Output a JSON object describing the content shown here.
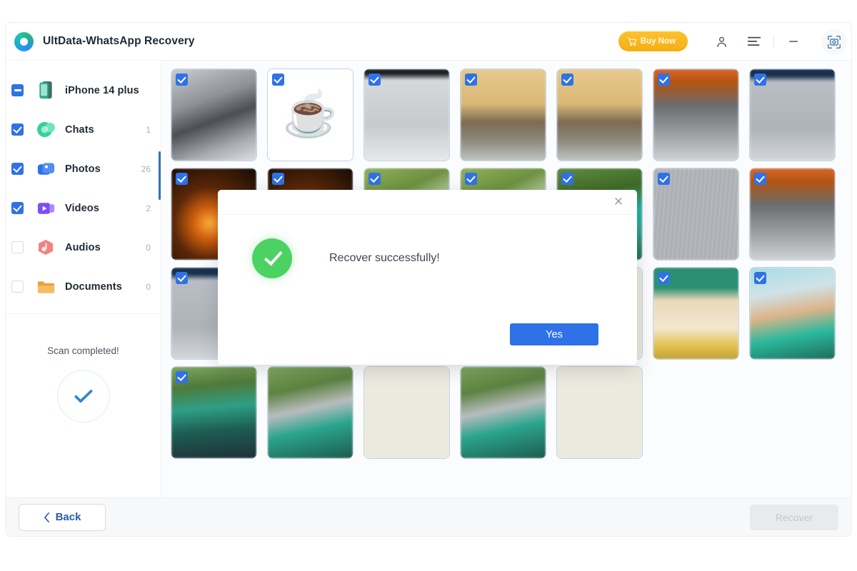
{
  "window": {
    "title": "UltData-WhatsApp Recovery",
    "logo_icon": "ultdata-ring-logo",
    "buy_now_label": "Buy Now",
    "buy_now_color": "#f5ae14",
    "cart_icon": "shopping-cart-icon",
    "user_icon": "user-account-icon",
    "menu_icon": "hamburger-menu-icon",
    "minimize_icon": "minimize-icon",
    "close_icon": "close-icon",
    "snip_icon": "screenshot-capture-icon"
  },
  "sidebar": {
    "items": [
      {
        "label": "iPhone 14 plus",
        "count": "",
        "checkbox": "indeterminate",
        "icon": "iphone-device-icon"
      },
      {
        "label": "Chats",
        "count": "1",
        "checkbox": "checked",
        "icon": "chats-icon"
      },
      {
        "label": "Photos",
        "count": "26",
        "checkbox": "checked",
        "icon": "photos-icon"
      },
      {
        "label": "Videos",
        "count": "2",
        "checkbox": "checked",
        "icon": "videos-icon"
      },
      {
        "label": "Audios",
        "count": "0",
        "checkbox": "unchecked",
        "icon": "audios-icon"
      },
      {
        "label": "Documents",
        "count": "0",
        "checkbox": "unchecked",
        "icon": "documents-icon"
      }
    ],
    "scan_status": "Scan completed!",
    "scan_icon": "check-mark-icon",
    "scan_accent": "#2f86d8"
  },
  "main": {
    "selected_color": "#2f72e8",
    "thumbnails": [
      {
        "art": "art-pen",
        "checked": true,
        "emoji": ""
      },
      {
        "art": "art-cup",
        "checked": true,
        "emoji": "☕"
      },
      {
        "art": "art-doc",
        "checked": true,
        "emoji": ""
      },
      {
        "art": "art-beach",
        "checked": true,
        "emoji": ""
      },
      {
        "art": "art-beach",
        "checked": true,
        "emoji": ""
      },
      {
        "art": "art-reel",
        "checked": true,
        "emoji": ""
      },
      {
        "art": "art-screen",
        "checked": true,
        "emoji": ""
      },
      {
        "art": "art-fire",
        "checked": true,
        "emoji": ""
      },
      {
        "art": "art-fire",
        "checked": true,
        "emoji": ""
      },
      {
        "art": "art-garden",
        "checked": true,
        "emoji": ""
      },
      {
        "art": "art-garden",
        "checked": true,
        "emoji": ""
      },
      {
        "art": "art-green",
        "checked": true,
        "emoji": ""
      },
      {
        "art": "art-grid",
        "checked": true,
        "emoji": ""
      },
      {
        "art": "art-reel",
        "checked": true,
        "emoji": ""
      },
      {
        "art": "art-screen",
        "checked": true,
        "emoji": ""
      },
      {
        "art": "art-blank",
        "checked": false,
        "emoji": ""
      },
      {
        "art": "art-blank",
        "checked": false,
        "emoji": ""
      },
      {
        "art": "art-blank",
        "checked": false,
        "emoji": ""
      },
      {
        "art": "art-blank",
        "checked": false,
        "emoji": ""
      },
      {
        "art": "art-latte",
        "checked": true,
        "emoji": ""
      },
      {
        "art": "art-shop",
        "checked": true,
        "emoji": ""
      },
      {
        "art": "art-street",
        "checked": true,
        "emoji": ""
      },
      {
        "art": "art-bike",
        "checked": false,
        "emoji": ""
      },
      {
        "art": "art-blank",
        "checked": false,
        "emoji": ""
      },
      {
        "art": "art-bike",
        "checked": false,
        "emoji": ""
      },
      {
        "art": "art-blank",
        "checked": false,
        "emoji": ""
      }
    ]
  },
  "footer": {
    "back_label": "Back",
    "back_icon": "chevron-left-icon",
    "recover_label": "Recover",
    "recover_disabled": true
  },
  "modal": {
    "message": "Recover successfully!",
    "confirm_label": "Yes",
    "close_icon": "close-icon",
    "success_icon": "success-check-icon",
    "success_color": "#4cd263",
    "confirm_color": "#2f72e8"
  }
}
